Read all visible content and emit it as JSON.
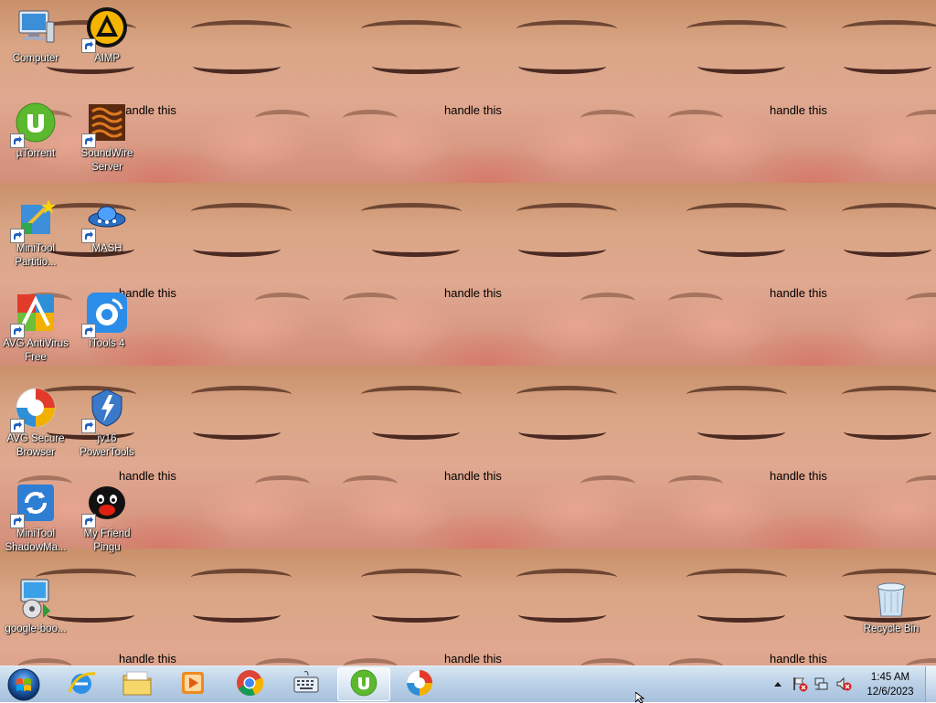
{
  "wallpaper": {
    "caption": "handle this"
  },
  "desktop_icons": [
    {
      "label": "Computer",
      "icon": "computer-icon",
      "shortcut": false
    },
    {
      "label": "AIMP",
      "icon": "aimp-icon",
      "shortcut": true
    },
    {
      "label": "µTorrent",
      "icon": "utorrent-icon",
      "shortcut": true
    },
    {
      "label": "SoundWire Server",
      "icon": "soundwire-icon",
      "shortcut": true
    },
    {
      "label": "MiniTool Partitio...",
      "icon": "minitool-partition-icon",
      "shortcut": true
    },
    {
      "label": "MASH",
      "icon": "mash-icon",
      "shortcut": true
    },
    {
      "label": "AVG AntiVirus Free",
      "icon": "avg-antivirus-icon",
      "shortcut": true
    },
    {
      "label": "iTools 4",
      "icon": "itools-icon",
      "shortcut": true
    },
    {
      "label": "AVG Secure Browser",
      "icon": "avg-browser-icon",
      "shortcut": true
    },
    {
      "label": "jv16 PowerTools",
      "icon": "jv16-icon",
      "shortcut": true
    },
    {
      "label": "MiniTool ShadowMa...",
      "icon": "minitool-shadowmaker-icon",
      "shortcut": true
    },
    {
      "label": "My Friend Pingu",
      "icon": "pingu-icon",
      "shortcut": true
    },
    {
      "label": "google-boo...",
      "icon": "installer-icon",
      "shortcut": false
    },
    {
      "label": "Recycle Bin",
      "icon": "recycle-bin-icon",
      "shortcut": false
    }
  ],
  "taskbar": {
    "start_icon": "windows-start-icon",
    "pinned": [
      {
        "name": "internet-explorer-icon",
        "active": false
      },
      {
        "name": "file-explorer-icon",
        "active": false
      },
      {
        "name": "media-player-icon",
        "active": false
      },
      {
        "name": "chrome-icon",
        "active": false
      },
      {
        "name": "on-screen-keyboard-icon",
        "active": false
      },
      {
        "name": "utorrent-icon",
        "active": true
      },
      {
        "name": "avg-browser-icon",
        "active": false
      }
    ],
    "tray": [
      "show-hidden-icons-icon",
      "action-center-flag-icon",
      "network-icon",
      "volume-muted-icon"
    ],
    "clock": {
      "time": "1:45 AM",
      "date": "12/6/2023"
    }
  },
  "colors": {
    "taskbar": "#bcd2e8",
    "label_text": "#ffffff",
    "caption_text": "#000000"
  }
}
